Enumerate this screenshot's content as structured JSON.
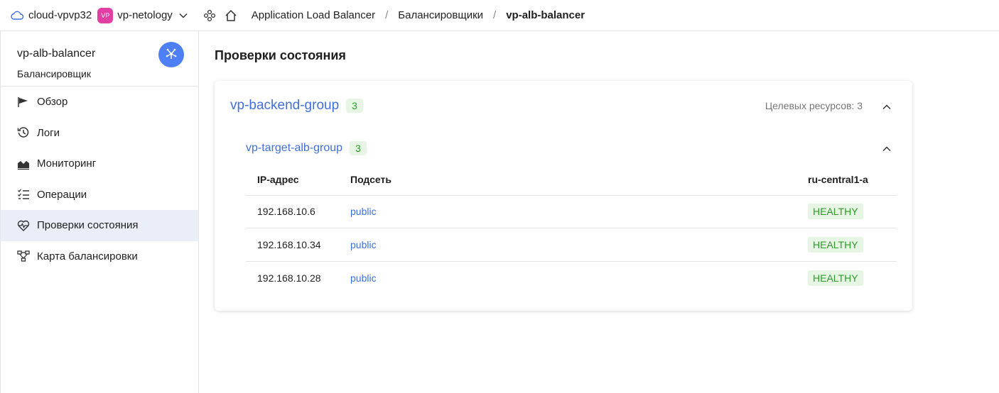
{
  "topbar": {
    "cloud_name": "cloud-vpvp32",
    "folder_badge": "VP",
    "folder_name": "vp-netology",
    "breadcrumbs": [
      "Application Load Balancer",
      "Балансировщики",
      "vp-alb-balancer"
    ],
    "separator": "/"
  },
  "sidebar": {
    "title": "vp-alb-balancer",
    "subtitle": "Балансировщик",
    "items": [
      {
        "label": "Обзор",
        "icon": "flag-icon"
      },
      {
        "label": "Логи",
        "icon": "history-icon"
      },
      {
        "label": "Мониторинг",
        "icon": "chart-area-icon"
      },
      {
        "label": "Операции",
        "icon": "list-check-icon"
      },
      {
        "label": "Проверки состояния",
        "icon": "heart-pulse-icon",
        "active": true
      },
      {
        "label": "Карта балансировки",
        "icon": "nodes-icon"
      }
    ]
  },
  "main": {
    "title": "Проверки состояния",
    "backend_group": {
      "name": "vp-backend-group",
      "count": "3",
      "meta": "Целевых ресурсов: 3"
    },
    "target_group": {
      "name": "vp-target-alb-group",
      "count": "3"
    },
    "table": {
      "headers": [
        "IP-адрес",
        "Подсеть",
        "ru-central1-a"
      ],
      "rows": [
        {
          "ip": "192.168.10.6",
          "subnet": "public",
          "status": "HEALTHY"
        },
        {
          "ip": "192.168.10.34",
          "subnet": "public",
          "status": "HEALTHY"
        },
        {
          "ip": "192.168.10.28",
          "subnet": "public",
          "status": "HEALTHY"
        }
      ]
    }
  },
  "colors": {
    "accent": "#4f7ff5",
    "link": "#3f6fe0",
    "healthy_bg": "#e6f5e4",
    "healthy_text": "#2e9b2b",
    "folder_badge": "#e33fa3"
  }
}
